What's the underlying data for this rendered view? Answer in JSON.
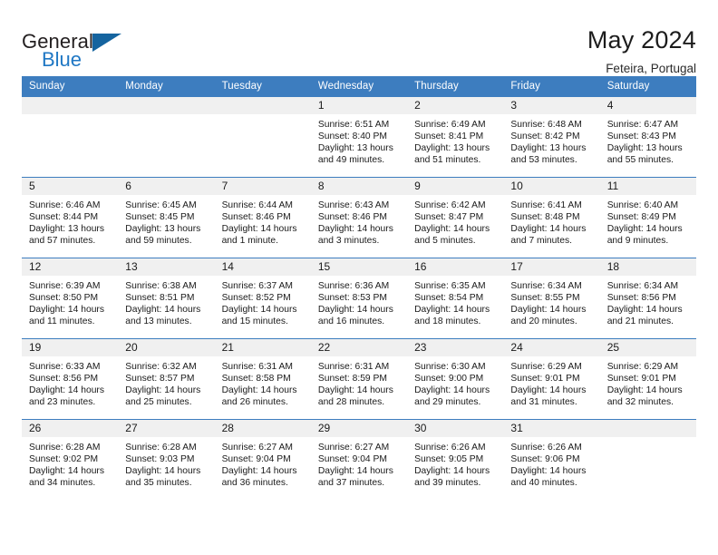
{
  "brand": {
    "name_part1": "General",
    "name_part2": "Blue",
    "triangle_color": "#15649f",
    "blue_color": "#1f77c4"
  },
  "header": {
    "title": "May 2024",
    "subtitle": "Feteira, Portugal",
    "header_bg": "#3d7dbf",
    "daynum_bg": "#f0f0f0"
  },
  "weekday_headers": [
    "Sunday",
    "Monday",
    "Tuesday",
    "Wednesday",
    "Thursday",
    "Friday",
    "Saturday"
  ],
  "weeks": [
    [
      {
        "day": "",
        "sunrise": "",
        "sunset": "",
        "daylight": ""
      },
      {
        "day": "",
        "sunrise": "",
        "sunset": "",
        "daylight": ""
      },
      {
        "day": "",
        "sunrise": "",
        "sunset": "",
        "daylight": ""
      },
      {
        "day": "1",
        "sunrise": "Sunrise: 6:51 AM",
        "sunset": "Sunset: 8:40 PM",
        "daylight": "Daylight: 13 hours and 49 minutes."
      },
      {
        "day": "2",
        "sunrise": "Sunrise: 6:49 AM",
        "sunset": "Sunset: 8:41 PM",
        "daylight": "Daylight: 13 hours and 51 minutes."
      },
      {
        "day": "3",
        "sunrise": "Sunrise: 6:48 AM",
        "sunset": "Sunset: 8:42 PM",
        "daylight": "Daylight: 13 hours and 53 minutes."
      },
      {
        "day": "4",
        "sunrise": "Sunrise: 6:47 AM",
        "sunset": "Sunset: 8:43 PM",
        "daylight": "Daylight: 13 hours and 55 minutes."
      }
    ],
    [
      {
        "day": "5",
        "sunrise": "Sunrise: 6:46 AM",
        "sunset": "Sunset: 8:44 PM",
        "daylight": "Daylight: 13 hours and 57 minutes."
      },
      {
        "day": "6",
        "sunrise": "Sunrise: 6:45 AM",
        "sunset": "Sunset: 8:45 PM",
        "daylight": "Daylight: 13 hours and 59 minutes."
      },
      {
        "day": "7",
        "sunrise": "Sunrise: 6:44 AM",
        "sunset": "Sunset: 8:46 PM",
        "daylight": "Daylight: 14 hours and 1 minute."
      },
      {
        "day": "8",
        "sunrise": "Sunrise: 6:43 AM",
        "sunset": "Sunset: 8:46 PM",
        "daylight": "Daylight: 14 hours and 3 minutes."
      },
      {
        "day": "9",
        "sunrise": "Sunrise: 6:42 AM",
        "sunset": "Sunset: 8:47 PM",
        "daylight": "Daylight: 14 hours and 5 minutes."
      },
      {
        "day": "10",
        "sunrise": "Sunrise: 6:41 AM",
        "sunset": "Sunset: 8:48 PM",
        "daylight": "Daylight: 14 hours and 7 minutes."
      },
      {
        "day": "11",
        "sunrise": "Sunrise: 6:40 AM",
        "sunset": "Sunset: 8:49 PM",
        "daylight": "Daylight: 14 hours and 9 minutes."
      }
    ],
    [
      {
        "day": "12",
        "sunrise": "Sunrise: 6:39 AM",
        "sunset": "Sunset: 8:50 PM",
        "daylight": "Daylight: 14 hours and 11 minutes."
      },
      {
        "day": "13",
        "sunrise": "Sunrise: 6:38 AM",
        "sunset": "Sunset: 8:51 PM",
        "daylight": "Daylight: 14 hours and 13 minutes."
      },
      {
        "day": "14",
        "sunrise": "Sunrise: 6:37 AM",
        "sunset": "Sunset: 8:52 PM",
        "daylight": "Daylight: 14 hours and 15 minutes."
      },
      {
        "day": "15",
        "sunrise": "Sunrise: 6:36 AM",
        "sunset": "Sunset: 8:53 PM",
        "daylight": "Daylight: 14 hours and 16 minutes."
      },
      {
        "day": "16",
        "sunrise": "Sunrise: 6:35 AM",
        "sunset": "Sunset: 8:54 PM",
        "daylight": "Daylight: 14 hours and 18 minutes."
      },
      {
        "day": "17",
        "sunrise": "Sunrise: 6:34 AM",
        "sunset": "Sunset: 8:55 PM",
        "daylight": "Daylight: 14 hours and 20 minutes."
      },
      {
        "day": "18",
        "sunrise": "Sunrise: 6:34 AM",
        "sunset": "Sunset: 8:56 PM",
        "daylight": "Daylight: 14 hours and 21 minutes."
      }
    ],
    [
      {
        "day": "19",
        "sunrise": "Sunrise: 6:33 AM",
        "sunset": "Sunset: 8:56 PM",
        "daylight": "Daylight: 14 hours and 23 minutes."
      },
      {
        "day": "20",
        "sunrise": "Sunrise: 6:32 AM",
        "sunset": "Sunset: 8:57 PM",
        "daylight": "Daylight: 14 hours and 25 minutes."
      },
      {
        "day": "21",
        "sunrise": "Sunrise: 6:31 AM",
        "sunset": "Sunset: 8:58 PM",
        "daylight": "Daylight: 14 hours and 26 minutes."
      },
      {
        "day": "22",
        "sunrise": "Sunrise: 6:31 AM",
        "sunset": "Sunset: 8:59 PM",
        "daylight": "Daylight: 14 hours and 28 minutes."
      },
      {
        "day": "23",
        "sunrise": "Sunrise: 6:30 AM",
        "sunset": "Sunset: 9:00 PM",
        "daylight": "Daylight: 14 hours and 29 minutes."
      },
      {
        "day": "24",
        "sunrise": "Sunrise: 6:29 AM",
        "sunset": "Sunset: 9:01 PM",
        "daylight": "Daylight: 14 hours and 31 minutes."
      },
      {
        "day": "25",
        "sunrise": "Sunrise: 6:29 AM",
        "sunset": "Sunset: 9:01 PM",
        "daylight": "Daylight: 14 hours and 32 minutes."
      }
    ],
    [
      {
        "day": "26",
        "sunrise": "Sunrise: 6:28 AM",
        "sunset": "Sunset: 9:02 PM",
        "daylight": "Daylight: 14 hours and 34 minutes."
      },
      {
        "day": "27",
        "sunrise": "Sunrise: 6:28 AM",
        "sunset": "Sunset: 9:03 PM",
        "daylight": "Daylight: 14 hours and 35 minutes."
      },
      {
        "day": "28",
        "sunrise": "Sunrise: 6:27 AM",
        "sunset": "Sunset: 9:04 PM",
        "daylight": "Daylight: 14 hours and 36 minutes."
      },
      {
        "day": "29",
        "sunrise": "Sunrise: 6:27 AM",
        "sunset": "Sunset: 9:04 PM",
        "daylight": "Daylight: 14 hours and 37 minutes."
      },
      {
        "day": "30",
        "sunrise": "Sunrise: 6:26 AM",
        "sunset": "Sunset: 9:05 PM",
        "daylight": "Daylight: 14 hours and 39 minutes."
      },
      {
        "day": "31",
        "sunrise": "Sunrise: 6:26 AM",
        "sunset": "Sunset: 9:06 PM",
        "daylight": "Daylight: 14 hours and 40 minutes."
      },
      {
        "day": "",
        "sunrise": "",
        "sunset": "",
        "daylight": ""
      }
    ]
  ]
}
